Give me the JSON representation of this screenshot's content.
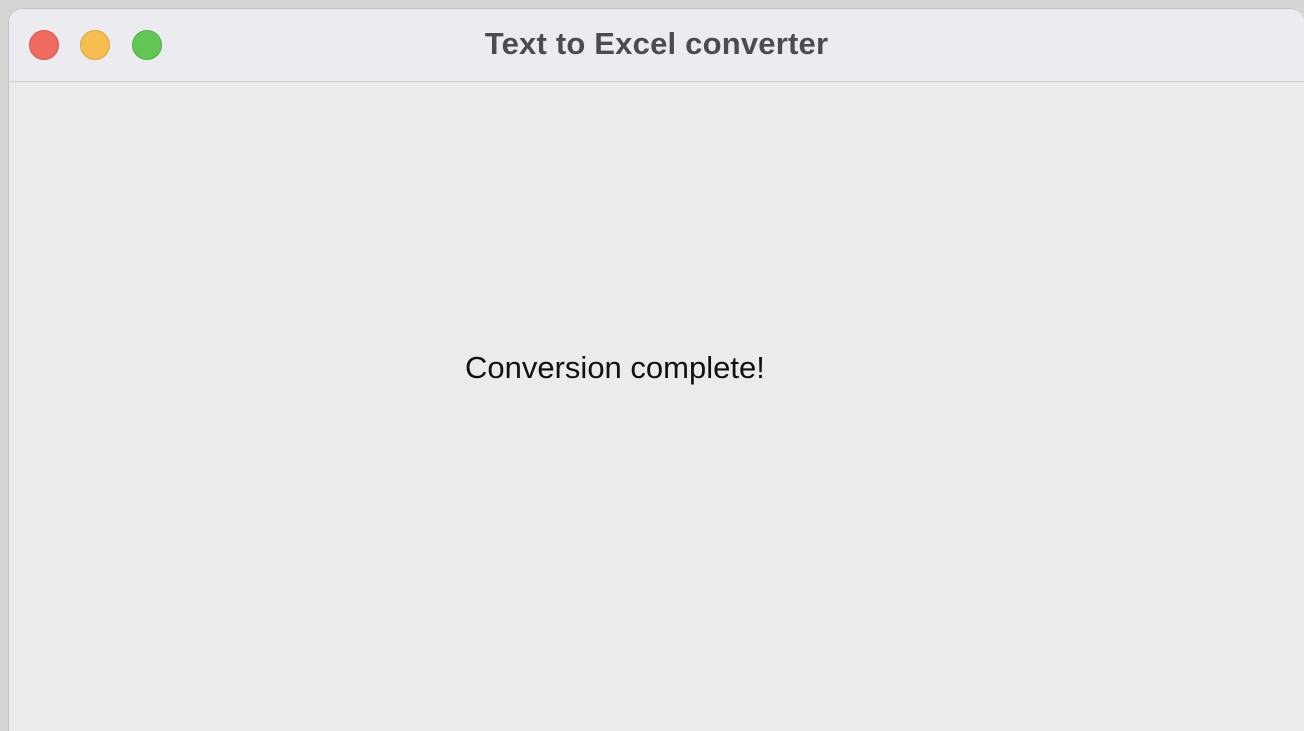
{
  "window": {
    "title": "Text to Excel converter",
    "controls": {
      "close_color": "#ef6a5f",
      "minimize_color": "#f6bd4f",
      "zoom_color": "#62c655"
    }
  },
  "content": {
    "message": "Conversion complete!"
  }
}
